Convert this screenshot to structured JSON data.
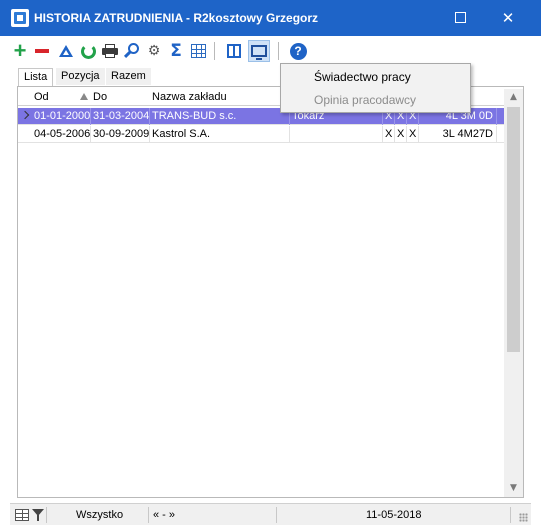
{
  "window": {
    "title": "HISTORIA ZATRUDNIENIA - R2kosztowy Grzegorz",
    "close_glyph": "✕"
  },
  "toolbar": {
    "icons": [
      "add-icon",
      "remove-icon",
      "edit-icon",
      "refresh-icon",
      "print-icon",
      "search-icon",
      "settings-icon",
      "sum-icon",
      "grid-icon",
      "columns-icon",
      "monitor-icon",
      "help-icon"
    ],
    "help_glyph": "?"
  },
  "tabs": [
    {
      "label": "Lista"
    },
    {
      "label": "Pozycja"
    },
    {
      "label": "Razem"
    }
  ],
  "grid": {
    "columns": [
      "Od",
      "Do",
      "Nazwa zakładu"
    ],
    "rows": [
      {
        "od": "01-01-2000",
        "do": "31-03-2004",
        "nazwa": "TRANS-BUD s.c.",
        "stanowisko": "Tokarz",
        "x1": "X",
        "x2": "X",
        "x3": "X",
        "okres": "4L 3M 0D"
      },
      {
        "od": "04-05-2006",
        "do": "30-09-2009",
        "nazwa": "Kastrol S.A.",
        "stanowisko": "",
        "x1": "X",
        "x2": "X",
        "x3": "X",
        "okres": "3L 4M27D"
      }
    ]
  },
  "dropdown_menu": {
    "items": [
      {
        "label": "Świadectwo pracy",
        "enabled": true
      },
      {
        "label": "Opinia pracodawcy",
        "enabled": false
      }
    ]
  },
  "statusbar": {
    "filter": "Wszystko",
    "nav": "« - »",
    "date": "11-05-2018"
  },
  "colors": {
    "titlebar": "#1e64c8",
    "selected_row": "#7b74e3"
  }
}
